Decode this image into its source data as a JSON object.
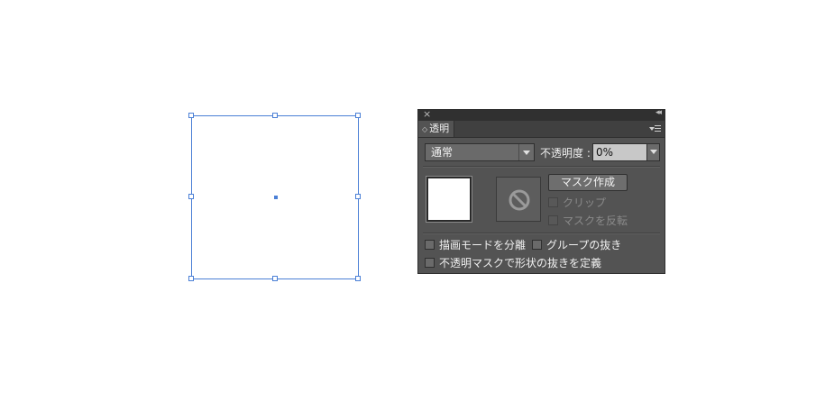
{
  "panel": {
    "close_glyph": "×",
    "collapse_glyph": "◂◂",
    "tab_arrows": "◇",
    "tab_label": "透明",
    "blend_mode": "通常",
    "opacity_label": "不透明度 :",
    "opacity_value": "0%",
    "make_mask_label": "マスク作成",
    "clip_label": "クリップ",
    "invert_mask_label": "マスクを反転",
    "isolate_blending_label": "描画モードを分離",
    "knockout_group_label": "グループの抜き",
    "opacity_mask_knockout_label": "不透明マスクで形状の抜きを定義"
  },
  "colors": {
    "selection_blue": "#4a7fd6",
    "panel_bg": "#535353"
  }
}
